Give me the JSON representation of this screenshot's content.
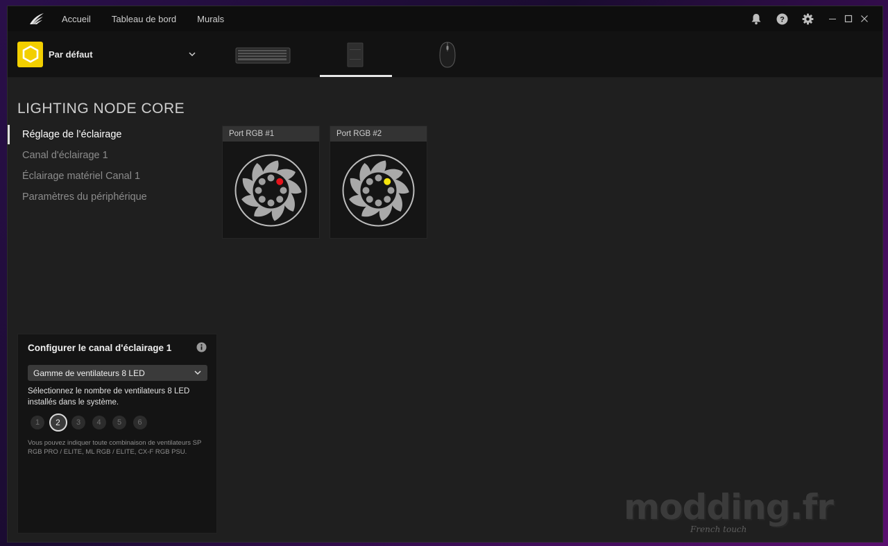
{
  "nav": {
    "links": [
      "Accueil",
      "Tableau de bord",
      "Murals"
    ]
  },
  "icons": {
    "logo": "corsair-sails-icon",
    "notifications": "bell-icon",
    "help": "question-circle-icon",
    "settings": "gear-icon",
    "minimize": "minimize-icon",
    "maximize": "maximize-icon",
    "close": "close-icon"
  },
  "profile": {
    "name": "Par défaut",
    "badge_color": "#f2cf00"
  },
  "devices": [
    {
      "name": "keyboard",
      "icon": "keyboard-icon"
    },
    {
      "name": "lighting-node-core",
      "icon": "lighting-node-icon",
      "active": true
    },
    {
      "name": "mouse",
      "icon": "mouse-icon"
    }
  ],
  "page": {
    "title": "LIGHTING NODE CORE"
  },
  "side_nav": {
    "items": [
      "Réglage de l’éclairage",
      "Canal d'éclairage 1",
      "Éclairage matériel Canal 1",
      "Paramètres du périphérique"
    ],
    "active_index": 0
  },
  "ports": [
    {
      "label": "Port RGB #1",
      "led_color": "#e5141c"
    },
    {
      "label": "Port RGB #2",
      "led_color": "#f4e40c"
    }
  ],
  "config": {
    "title": "Configurer le canal d'éclairage 1",
    "select_value": "Gamme de ventilateurs 8 LED",
    "description": "Sélectionnez le nombre de ventilateurs 8 LED installés dans le système.",
    "counts": [
      "1",
      "2",
      "3",
      "4",
      "5",
      "6"
    ],
    "selected_count": "2",
    "note": "Vous pouvez indiquer toute combinaison de ventilateurs SP RGB PRO / ELITE, ML RGB / ELITE, CX-F RGB PSU."
  },
  "watermark": {
    "text": "modding.fr",
    "subtitle": "French touch"
  }
}
